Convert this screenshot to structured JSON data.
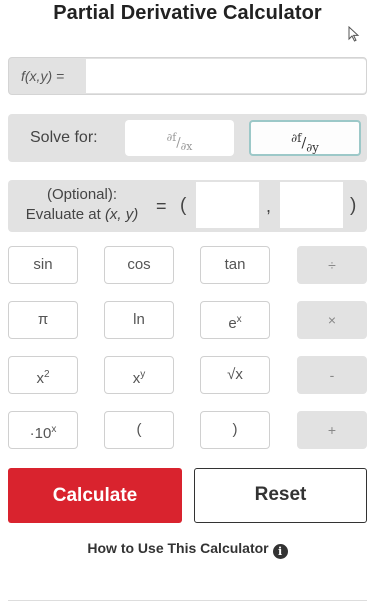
{
  "header": {
    "title": "Partial Derivative Calculator"
  },
  "function_input": {
    "label": "f(x,y) =",
    "value": "",
    "placeholder": ""
  },
  "solve_for": {
    "label": "Solve for:",
    "options": [
      {
        "num": "∂f",
        "den": "∂x",
        "selected": false
      },
      {
        "num": "∂f",
        "den": "∂y",
        "selected": true
      }
    ]
  },
  "evaluate": {
    "label_line1": "(Optional):",
    "label_line2_prefix": "Evaluate at ",
    "label_line2_vars": "(x, y)",
    "equals": "=",
    "open_paren": "(",
    "comma": ",",
    "close_paren": ")",
    "x_value": "",
    "y_value": ""
  },
  "keypad": {
    "sin": "sin",
    "cos": "cos",
    "tan": "tan",
    "divide": "÷",
    "pi": "π",
    "ln": "ln",
    "e_base": "e",
    "e_exp": "x",
    "multiply": "×",
    "sq_base": "x",
    "sq_exp": "2",
    "pow_base": "x",
    "pow_exp": "y",
    "sqrt": "√x",
    "minus": "-",
    "sci_base": "·10",
    "sci_exp": "x",
    "lparen": "(",
    "rparen": ")",
    "plus": "+"
  },
  "actions": {
    "calculate": "Calculate",
    "reset": "Reset"
  },
  "help": {
    "howto": "How to Use This Calculator",
    "info_glyph": "i"
  },
  "colors": {
    "accent_red": "#d9232e",
    "panel_gray": "#e2e2e2",
    "selected_border": "#9cc8c8"
  }
}
